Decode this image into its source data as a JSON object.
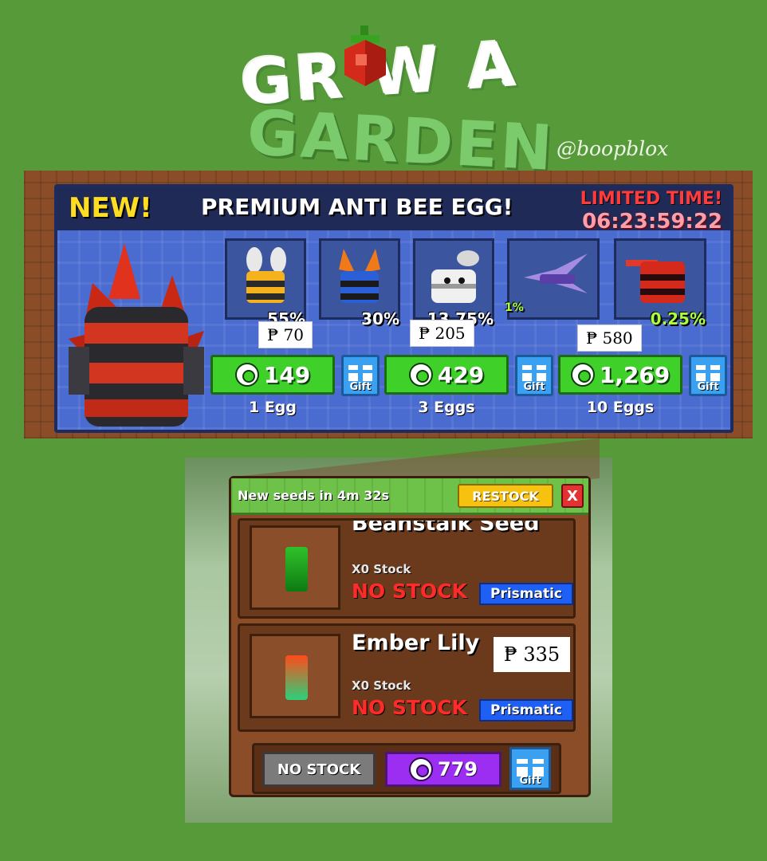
{
  "logo": {
    "line1": "GR  W A",
    "line2": "GARDEN",
    "handle": "@boopblox"
  },
  "egg_shop": {
    "badge": "NEW!",
    "title": "PREMIUM ANTI BEE EGG!",
    "limited_label": "LIMITED TIME!",
    "timer": "06:23:59:22",
    "pets": [
      {
        "icon": "honey-bee-icon",
        "chance": "55%"
      },
      {
        "icon": "blue-bee-icon",
        "chance": "30%"
      },
      {
        "icon": "white-bee-icon",
        "chance": "13.75%"
      },
      {
        "icon": "purple-dragonfly-icon",
        "chance": "1%"
      },
      {
        "icon": "red-bee-icon",
        "chance": "0.25%"
      }
    ],
    "price_tags": [
      "₱ 70",
      "₱ 205",
      "₱ 580"
    ],
    "options": [
      {
        "price": "149",
        "qty": "1 Egg"
      },
      {
        "price": "429",
        "qty": "3 Eggs"
      },
      {
        "price": "1,269",
        "qty": "10 Eggs"
      }
    ],
    "gift_label": "Gift"
  },
  "seed_shop": {
    "timer": "New seeds in 4m 32s",
    "restock_label": "RESTOCK",
    "close_label": "X",
    "seeds": [
      {
        "name": "Beanstalk Seed",
        "stock": "X0 Stock",
        "status": "NO STOCK",
        "rarity": "Prismatic"
      },
      {
        "name": "Ember Lily",
        "stock": "X0 Stock",
        "status": "NO STOCK",
        "rarity": "Prismatic",
        "price_tag": "₱ 335"
      }
    ],
    "footer": {
      "nostock_label": "NO STOCK",
      "robux_price": "779",
      "gift_label": "Gift"
    }
  },
  "colors": {
    "background": "#579a3a",
    "buy_green": "#3fd12a",
    "robux_purple": "#9b2ef0",
    "prismatic_blue": "#1e5ff5",
    "no_stock_red": "#ff2a2a"
  }
}
